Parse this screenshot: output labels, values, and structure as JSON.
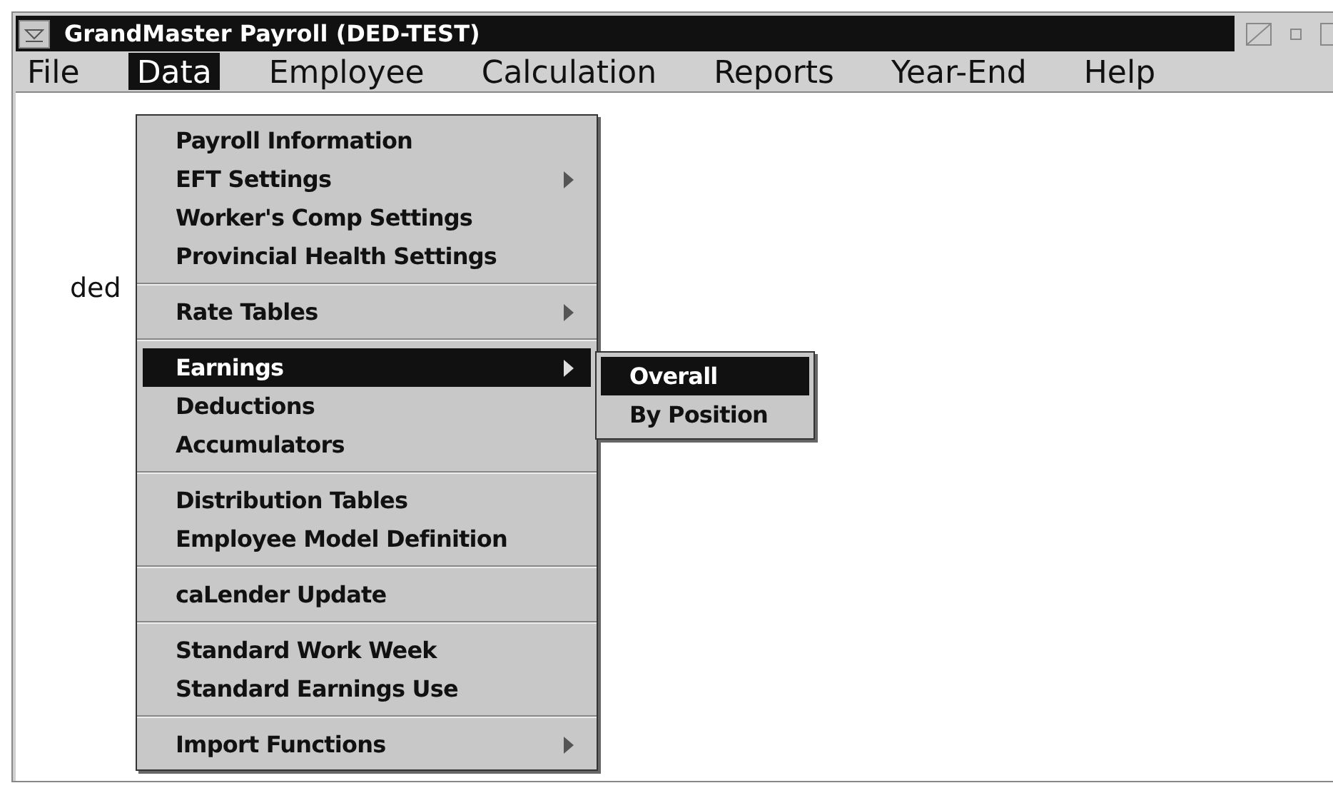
{
  "window": {
    "title": "GrandMaster Payroll (DED-TEST)"
  },
  "menubar": [
    {
      "label": "File",
      "selected": false
    },
    {
      "label": "Data",
      "selected": true
    },
    {
      "label": "Employee",
      "selected": false
    },
    {
      "label": "Calculation",
      "selected": false
    },
    {
      "label": "Reports",
      "selected": false
    },
    {
      "label": "Year-End",
      "selected": false
    },
    {
      "label": "Help",
      "selected": false
    }
  ],
  "client_text": "ded",
  "data_menu": [
    [
      {
        "label": "Payroll Information",
        "submenu": false,
        "selected": false
      },
      {
        "label": "EFT Settings",
        "submenu": true,
        "selected": false
      },
      {
        "label": "Worker's Comp Settings",
        "submenu": false,
        "selected": false
      },
      {
        "label": "Provincial Health Settings",
        "submenu": false,
        "selected": false
      }
    ],
    [
      {
        "label": "Rate Tables",
        "submenu": true,
        "selected": false
      }
    ],
    [
      {
        "label": "Earnings",
        "submenu": true,
        "selected": true
      },
      {
        "label": "Deductions",
        "submenu": false,
        "selected": false
      },
      {
        "label": "Accumulators",
        "submenu": false,
        "selected": false
      }
    ],
    [
      {
        "label": "Distribution Tables",
        "submenu": false,
        "selected": false
      },
      {
        "label": "Employee Model Definition",
        "submenu": false,
        "selected": false
      }
    ],
    [
      {
        "label": "caLender Update",
        "submenu": false,
        "selected": false
      }
    ],
    [
      {
        "label": "Standard Work Week",
        "submenu": false,
        "selected": false
      },
      {
        "label": "Standard Earnings Use",
        "submenu": false,
        "selected": false
      }
    ],
    [
      {
        "label": "Import Functions",
        "submenu": true,
        "selected": false
      }
    ]
  ],
  "earnings_submenu": [
    {
      "label": "Overall",
      "selected": true
    },
    {
      "label": "By Position",
      "selected": false
    }
  ]
}
